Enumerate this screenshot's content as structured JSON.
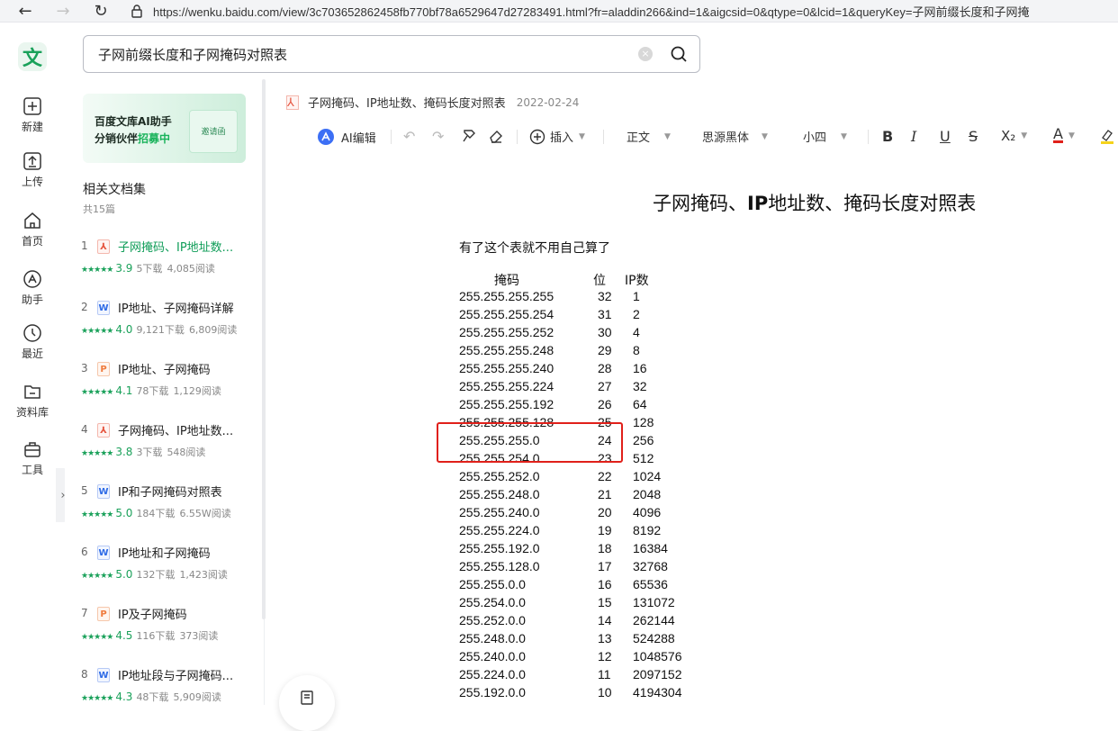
{
  "browser": {
    "url": "https://wenku.baidu.com/view/3c703652862458fb770bf78a6529647d27283491.html?fr=aladdin266&ind=1&aigcsid=0&qtype=0&lcid=1&queryKey=子网前缀长度和子网掩"
  },
  "sidebar": {
    "logo": "文",
    "items": [
      {
        "label": "新建",
        "icon": "plus-icon"
      },
      {
        "label": "上传",
        "icon": "upload-icon"
      },
      {
        "label": "首页",
        "icon": "home-icon"
      },
      {
        "label": "助手",
        "icon": "assistant-icon"
      },
      {
        "label": "最近",
        "icon": "clock-icon"
      },
      {
        "label": "资料库",
        "icon": "folder-icon"
      },
      {
        "label": "工具",
        "icon": "toolbox-icon"
      }
    ],
    "collapse": "›"
  },
  "search": {
    "value": "子网前缀长度和子网掩码对照表"
  },
  "banner": {
    "line1": "百度文库AI助手",
    "line2_a": "分销伙伴",
    "line2_b": "招募中",
    "card_text": "邀请函"
  },
  "related": {
    "title": "相关文档集",
    "count": "共15篇",
    "docs": [
      {
        "num": "1",
        "type": "pdf",
        "title": "子网掩码、IP地址数...",
        "stars": "★★★★★",
        "score": "3.9",
        "downloads": "5下载",
        "reads": "4,085阅读"
      },
      {
        "num": "2",
        "type": "word",
        "title": "IP地址、子网掩码详解",
        "stars": "★★★★★",
        "score": "4.0",
        "downloads": "9,121下载",
        "reads": "6,809阅读"
      },
      {
        "num": "3",
        "type": "ppt",
        "title": "IP地址、子网掩码",
        "stars": "★★★★★",
        "score": "4.1",
        "downloads": "78下载",
        "reads": "1,129阅读"
      },
      {
        "num": "4",
        "type": "pdf",
        "title": "子网掩码、IP地址数...",
        "stars": "★★★★★",
        "score": "3.8",
        "downloads": "3下载",
        "reads": "548阅读"
      },
      {
        "num": "5",
        "type": "word",
        "title": "IP和子网掩码对照表",
        "stars": "★★★★★",
        "score": "5.0",
        "downloads": "184下载",
        "reads": "6.55W阅读"
      },
      {
        "num": "6",
        "type": "word",
        "title": "IP地址和子网掩码",
        "stars": "★★★★★",
        "score": "5.0",
        "downloads": "132下载",
        "reads": "1,423阅读"
      },
      {
        "num": "7",
        "type": "ppt",
        "title": "IP及子网掩码",
        "stars": "★★★★★",
        "score": "4.5",
        "downloads": "116下载",
        "reads": "373阅读"
      },
      {
        "num": "8",
        "type": "word",
        "title": "IP地址段与子网掩码...",
        "stars": "★★★★★",
        "score": "4.3",
        "downloads": "48下载",
        "reads": "5,909阅读"
      }
    ]
  },
  "document": {
    "name": "子网掩码、IP地址数、掩码长度对照表",
    "date": "2022-02-24",
    "toolbar": {
      "ai_edit": "AI编辑",
      "insert": "插入",
      "style": "正文",
      "font": "思源黑体",
      "size": "小四",
      "bold": "B",
      "italic": "I",
      "underline": "U",
      "strike": "S",
      "subscript": "X₂",
      "color": "A"
    },
    "title_a": "子网掩码、",
    "title_b": "IP",
    "title_c": "地址数、掩码长度对照表",
    "intro": "有了这个表就不用自己算了",
    "headers": {
      "mask": "掩码",
      "bits": "位",
      "ips": "IP数"
    },
    "rows": [
      {
        "mask": "255.255.255.255",
        "bits": "32",
        "ips": "1"
      },
      {
        "mask": "255.255.255.254",
        "bits": "31",
        "ips": "2"
      },
      {
        "mask": "255.255.255.252",
        "bits": "30",
        "ips": "4"
      },
      {
        "mask": "255.255.255.248",
        "bits": "29",
        "ips": "8"
      },
      {
        "mask": "255.255.255.240",
        "bits": "28",
        "ips": "16"
      },
      {
        "mask": "255.255.255.224",
        "bits": "27",
        "ips": "32"
      },
      {
        "mask": "255.255.255.192",
        "bits": "26",
        "ips": "64"
      },
      {
        "mask": "255.255.255.128",
        "bits": "25",
        "ips": "128"
      },
      {
        "mask": "255.255.255.0",
        "bits": "24",
        "ips": "256"
      },
      {
        "mask": "255.255.254.0",
        "bits": "23",
        "ips": "512"
      },
      {
        "mask": "255.255.252.0",
        "bits": "22",
        "ips": "1024"
      },
      {
        "mask": "255.255.248.0",
        "bits": "21",
        "ips": "2048"
      },
      {
        "mask": "255.255.240.0",
        "bits": "20",
        "ips": "4096"
      },
      {
        "mask": "255.255.224.0",
        "bits": "19",
        "ips": "8192"
      },
      {
        "mask": "255.255.192.0",
        "bits": "18",
        "ips": "16384"
      },
      {
        "mask": "255.255.128.0",
        "bits": "17",
        "ips": "32768"
      },
      {
        "mask": "255.255.0.0",
        "bits": "16",
        "ips": "65536"
      },
      {
        "mask": "255.254.0.0",
        "bits": "15",
        "ips": "131072"
      },
      {
        "mask": "255.252.0.0",
        "bits": "14",
        "ips": "262144"
      },
      {
        "mask": "255.248.0.0",
        "bits": "13",
        "ips": "524288"
      },
      {
        "mask": "255.240.0.0",
        "bits": "12",
        "ips": "1048576"
      },
      {
        "mask": "255.224.0.0",
        "bits": "11",
        "ips": "2097152"
      },
      {
        "mask": "255.192.0.0",
        "bits": "10",
        "ips": "4194304"
      }
    ]
  },
  "colors": {
    "brand_green": "#1aa15a",
    "highlight_red": "#e0201a"
  }
}
